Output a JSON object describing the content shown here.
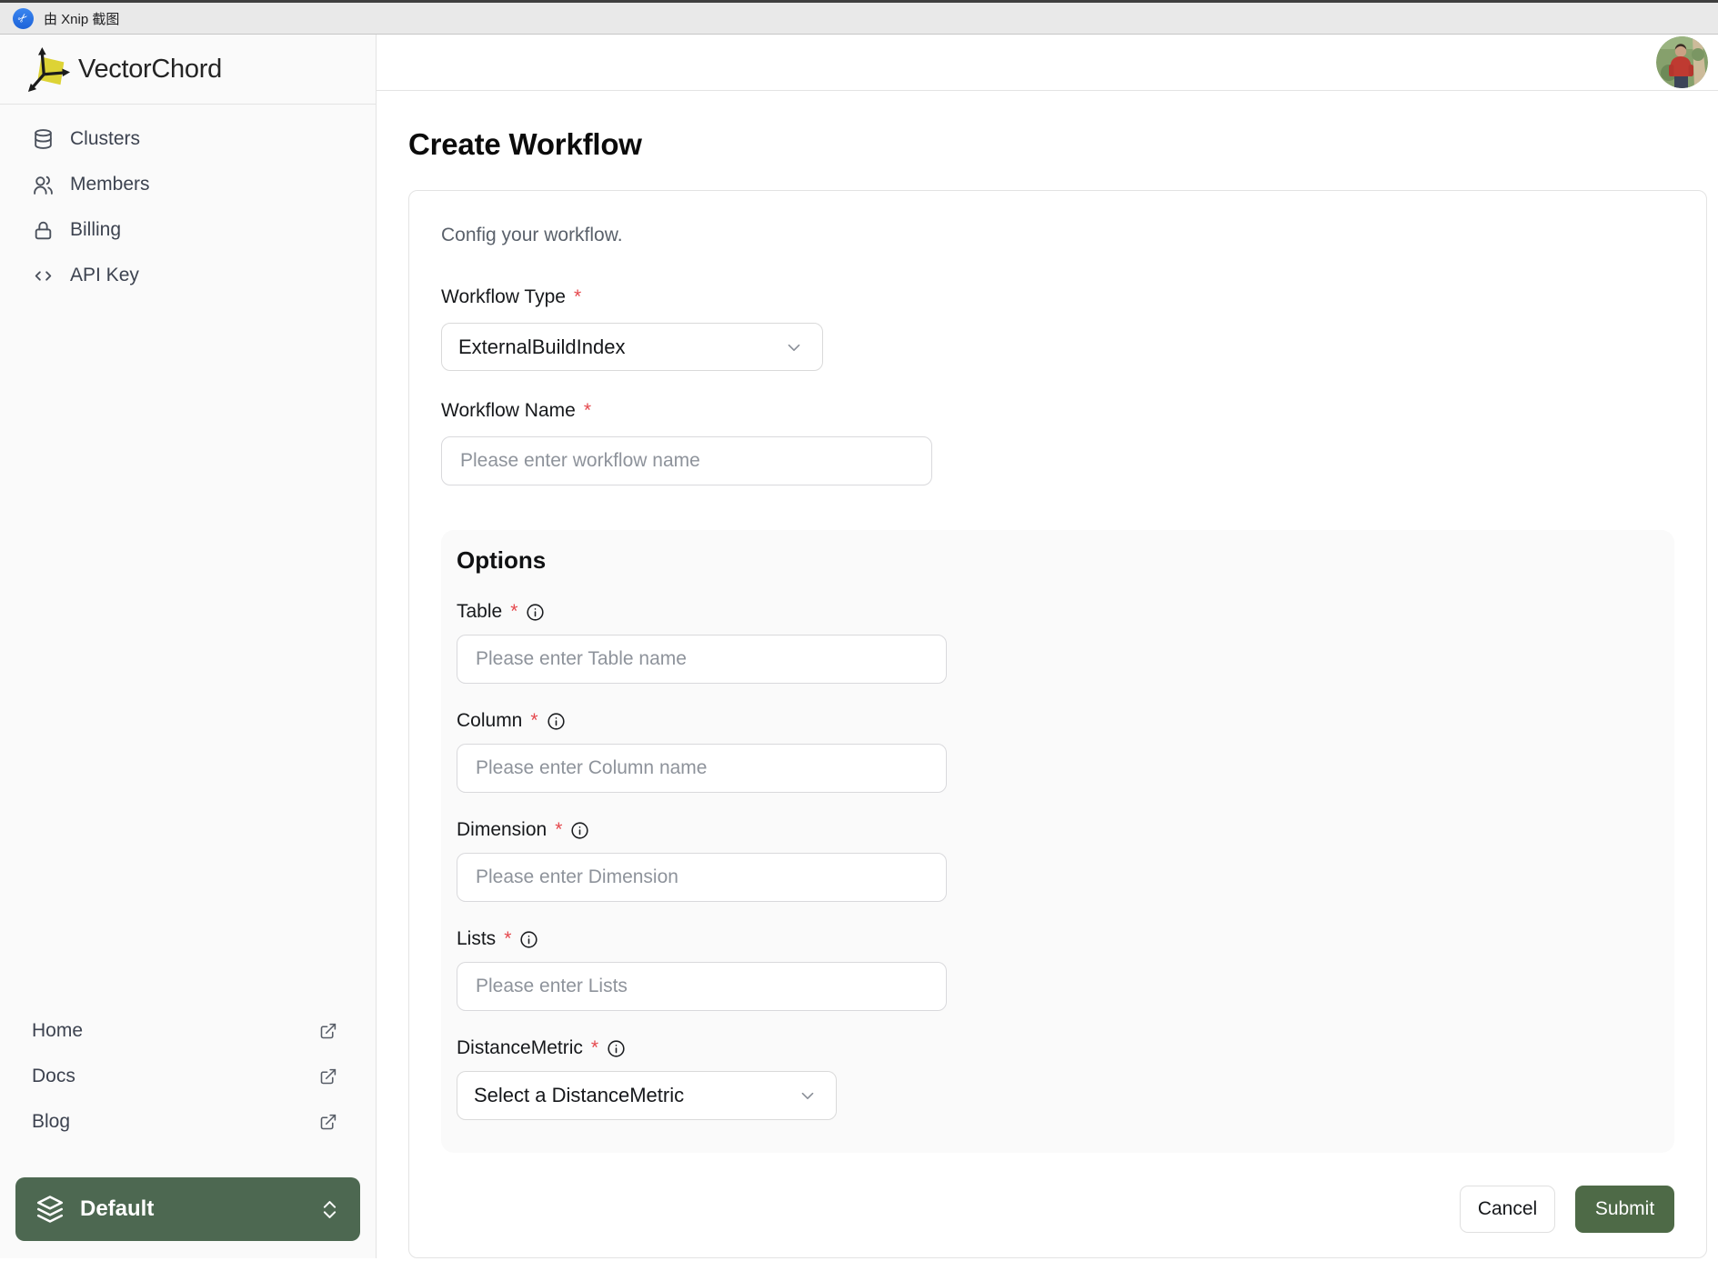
{
  "watermark": {
    "text": "由 Xnip 截图"
  },
  "brand": {
    "name": "VectorChord"
  },
  "sidebar": {
    "items": [
      {
        "label": "Clusters",
        "icon": "database-icon"
      },
      {
        "label": "Members",
        "icon": "users-icon"
      },
      {
        "label": "Billing",
        "icon": "lock-icon"
      },
      {
        "label": "API Key",
        "icon": "code-icon"
      }
    ],
    "links": [
      {
        "label": "Home",
        "icon": "external-link-icon"
      },
      {
        "label": "Docs",
        "icon": "external-link-icon"
      },
      {
        "label": "Blog",
        "icon": "external-link-icon"
      }
    ],
    "project_switcher": {
      "label": "Default",
      "icon": "layers-icon"
    }
  },
  "page": {
    "title": "Create Workflow"
  },
  "form": {
    "description": "Config your workflow.",
    "required_marker": "*",
    "workflow_type": {
      "label": "Workflow Type",
      "value": "ExternalBuildIndex"
    },
    "workflow_name": {
      "label": "Workflow Name",
      "placeholder": "Please enter workflow name"
    },
    "options": {
      "title": "Options",
      "fields": [
        {
          "label": "Table",
          "type": "input",
          "placeholder": "Please enter Table name"
        },
        {
          "label": "Column",
          "type": "input",
          "placeholder": "Please enter Column name"
        },
        {
          "label": "Dimension",
          "type": "input",
          "placeholder": "Please enter Dimension"
        },
        {
          "label": "Lists",
          "type": "input",
          "placeholder": "Please enter Lists"
        },
        {
          "label": "DistanceMetric",
          "type": "select",
          "value": "Select a DistanceMetric"
        }
      ]
    },
    "actions": {
      "cancel": "Cancel",
      "submit": "Submit"
    }
  },
  "colors": {
    "submit_green": "#4e6a47",
    "switcher_green": "#4d6851",
    "required_red": "#e5484d",
    "xnip_blue": "#1d63d8",
    "logo_yellow": "#ddd335"
  }
}
